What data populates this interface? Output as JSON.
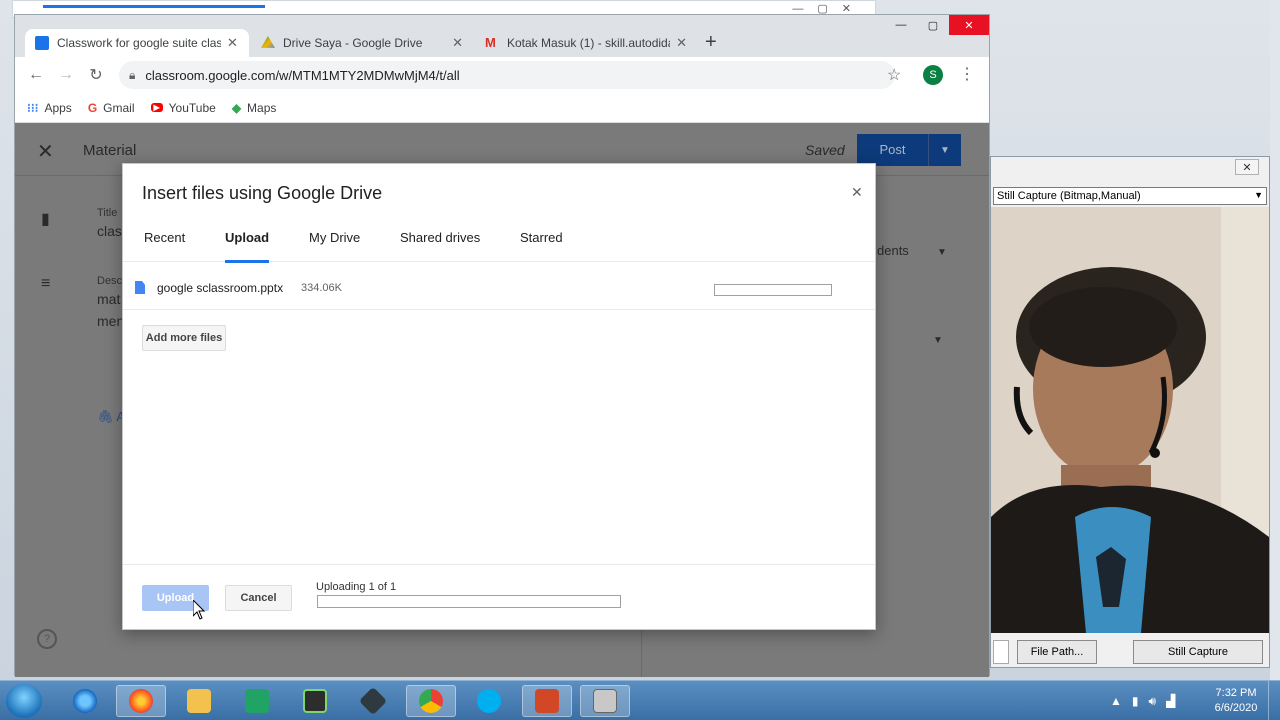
{
  "browser": {
    "tabs": [
      {
        "title": "Classwork for google suite classr",
        "icon": "classroom-icon",
        "color": "#1a73e8",
        "active": true
      },
      {
        "title": "Drive Saya - Google Drive",
        "icon": "drive-icon",
        "color": "#0f9d58",
        "active": false
      },
      {
        "title": "Kotak Masuk (1) - skill.autodidak",
        "icon": "gmail-icon",
        "color": "#d93025",
        "active": false
      }
    ],
    "url": "classroom.google.com/w/MTM1MTY2MDMwMjM4/t/all",
    "profile_initial": "S",
    "bookmarks": [
      {
        "label": "Apps",
        "icon": "apps-grid-icon"
      },
      {
        "label": "Gmail",
        "icon": "google-g-icon"
      },
      {
        "label": "YouTube",
        "icon": "youtube-icon"
      },
      {
        "label": "Maps",
        "icon": "maps-icon"
      }
    ]
  },
  "page": {
    "header_title": "Material",
    "saved_label": "Saved",
    "post_label": "Post",
    "title_label": "Title",
    "title_value": "clas",
    "description_label": "Desc",
    "description_line1": "mat",
    "description_line2": "men",
    "right_label": "dents",
    "attach_label": "A"
  },
  "dialog": {
    "title": "Insert files using Google Drive",
    "tabs": [
      "Recent",
      "Upload",
      "My Drive",
      "Shared drives",
      "Starred"
    ],
    "active_tab": "Upload",
    "file": {
      "name": "google sclassroom.pptx",
      "size": "334.06K",
      "progress": 0
    },
    "add_more_label": "Add more files",
    "upload_label": "Upload",
    "cancel_label": "Cancel",
    "status": "Uploading 1 of 1",
    "total_progress": 0
  },
  "capture_window": {
    "device": "Still Capture (Bitmap,Manual)",
    "file_path_label": "File Path...",
    "still_capture_label": "Still Capture"
  },
  "taskbar": {
    "time": "7:32 PM",
    "date": "6/6/2020"
  }
}
